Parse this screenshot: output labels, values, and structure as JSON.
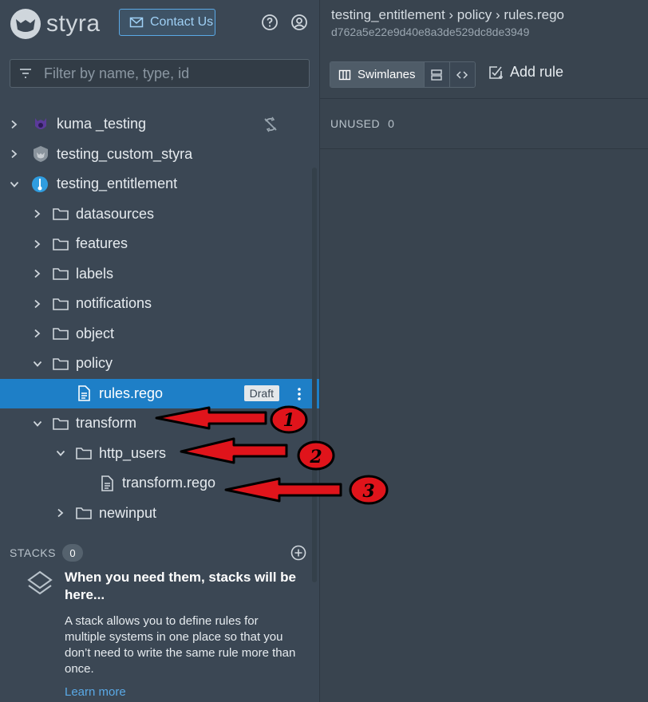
{
  "brand": {
    "name": "styra"
  },
  "header": {
    "contact_label": "Contact Us",
    "help_icon": "help-circle-icon",
    "account_icon": "user-circle-icon"
  },
  "filter": {
    "placeholder": "Filter by name, type, id",
    "value": ""
  },
  "tree": {
    "systems": [
      {
        "label": "kuma _testing",
        "icon": "kuma-logo-icon"
      },
      {
        "label": "testing_custom_styra",
        "icon": "styra-shield-icon"
      },
      {
        "label": "testing_entitlement",
        "icon": "entitlement-icon"
      }
    ],
    "folders": {
      "datasources": "datasources",
      "features": "features",
      "labels": "labels",
      "notifications": "notifications",
      "object": "object",
      "policy": "policy",
      "transform": "transform",
      "http_users": "http_users",
      "newinput": "newinput"
    },
    "files": {
      "rules": "rules.rego",
      "transform": "transform.rego"
    },
    "draft_badge": "Draft"
  },
  "stacks": {
    "title": "STACKS",
    "count": "0",
    "heading": "When you need them, stacks will be here...",
    "body": "A stack allows you to define rules for multiple systems in one place so that you don’t need to write the same rule more than once.",
    "learn_more": "Learn more"
  },
  "main": {
    "breadcrumb": "testing_entitlement › policy › rules.rego",
    "hash": "d762a5e22e9d40e8a3de529dc8de3949",
    "view_swimlanes": "Swimlanes",
    "add_rule": "Add rule",
    "unused_label": "UNUSED",
    "unused_count": "0"
  },
  "annotations": [
    "1",
    "2",
    "3"
  ],
  "colors": {
    "accent": "#1e7fc7",
    "link": "#5aa9e6",
    "arrow": "#e0141b"
  }
}
